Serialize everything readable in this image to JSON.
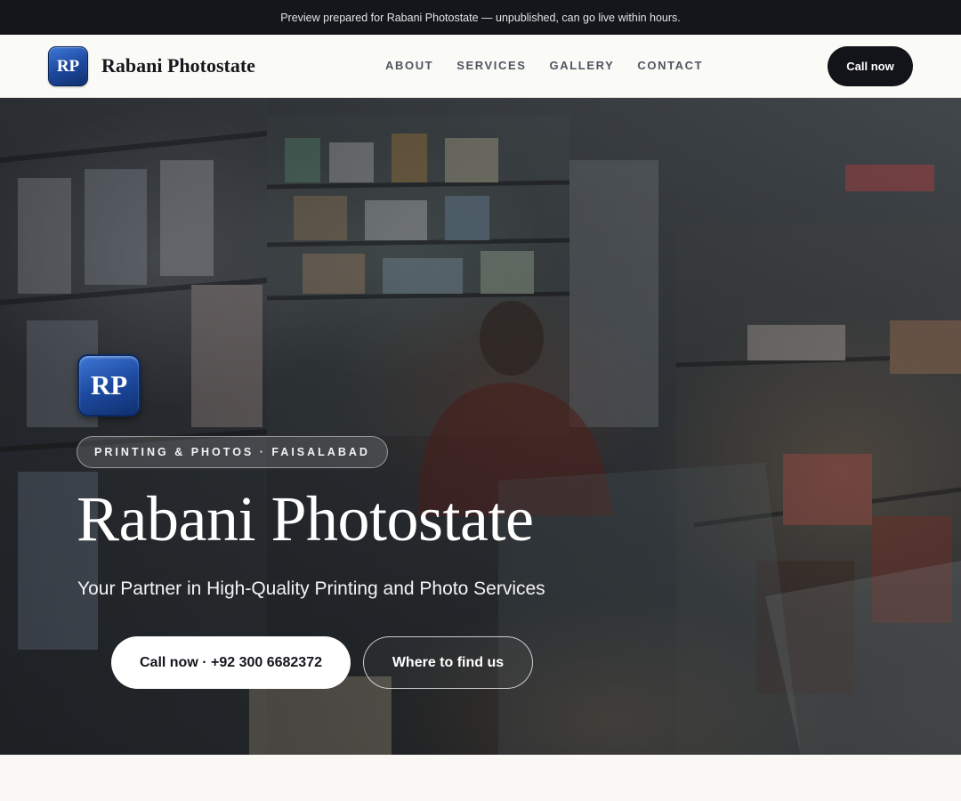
{
  "preview_banner": {
    "text": "Preview prepared for Rabani Photostate — unpublished, can go live within hours."
  },
  "header": {
    "logo_text": "RP",
    "brand": "Rabani Photostate",
    "nav": [
      {
        "label": "ABOUT"
      },
      {
        "label": "SERVICES"
      },
      {
        "label": "GALLERY"
      },
      {
        "label": "CONTACT"
      }
    ],
    "cta_label": "Call now"
  },
  "hero": {
    "logo_text": "RP",
    "eyebrow": "PRINTING & PHOTOS · FAISALABAD",
    "title": "Rabani Photostate",
    "subtitle": "Your Partner in High-Quality Printing and Photo Services",
    "primary_button": "Call now · +92 300 6682372",
    "secondary_button": "Where to find us"
  },
  "colors": {
    "topbar_bg": "#14161c",
    "logo_blue": "#1d4aa0",
    "nav_cta_bg": "#12141a",
    "page_bg": "#faf8f4"
  }
}
